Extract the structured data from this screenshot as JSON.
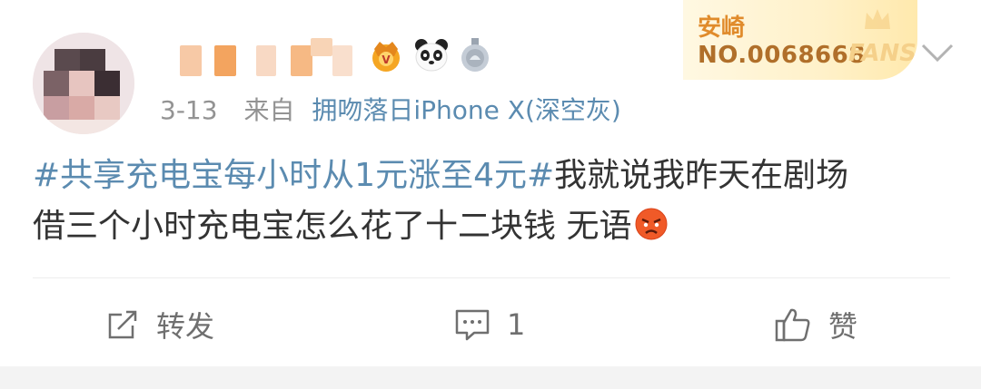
{
  "post": {
    "username": "",
    "date": "3-13",
    "source_label": "来自",
    "device": "拥吻落日iPhone X(深空灰)",
    "topic": "#共享充电宝每小时从1元涨至4元#",
    "body_line1": "我就说我昨天在剧场",
    "body_line2": "借三个小时充电宝怎么花了十二块钱 无语",
    "badges": [
      "crown-badge-icon",
      "panda-badge-icon",
      "silver-medal-icon"
    ],
    "emoji": "angry-face-emoji"
  },
  "fans_card": {
    "title": "安崎",
    "number": "NO.0068668",
    "label": "FANS"
  },
  "actions": {
    "repost_label": "转发",
    "comment_count": "1",
    "like_label": "赞"
  },
  "colors": {
    "link": "#5b8bb0",
    "meta_gray": "#939393",
    "text": "#333333",
    "fans_gold": "#e08b2b"
  }
}
